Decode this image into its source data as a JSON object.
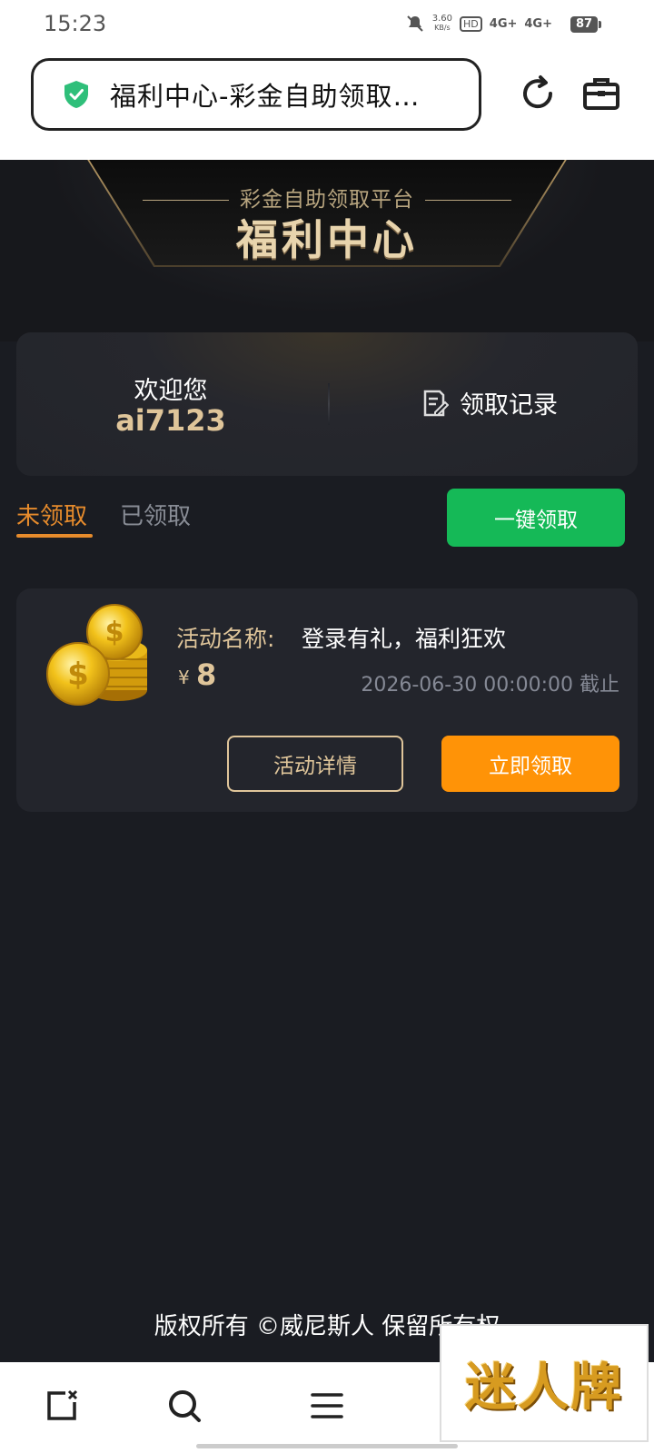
{
  "status_bar": {
    "time": "15:23",
    "speed_value": "3.60",
    "speed_unit": "KB/s",
    "hd": "HD",
    "network_1": "4G+",
    "network_2": "4G+",
    "battery": "87"
  },
  "browser": {
    "url_title": "福利中心-彩金自助领取…",
    "shield_icon": "shield-check-icon",
    "refresh_icon": "refresh-icon",
    "toolbox_icon": "toolbox-icon"
  },
  "hero": {
    "subtitle": "彩金自助领取平台",
    "title": "福利中心"
  },
  "welcome": {
    "label": "欢迎您",
    "username": "ai7123",
    "record_label": "领取记录",
    "record_icon": "document-edit-icon"
  },
  "tabs": {
    "unclaimed": "未领取",
    "claimed": "已领取",
    "active": "未领取"
  },
  "claim_all_label": "一键领取",
  "activity": {
    "label": "活动名称:",
    "name": "登录有礼，福利狂欢",
    "currency": "¥",
    "amount": "8",
    "deadline": "2026-06-30 00:00:00 截止",
    "detail_label": "活动详情",
    "claim_label": "立即领取",
    "image": "gold-coins"
  },
  "footer": {
    "copyright": "版权所有 ©威尼斯人 保留所有权"
  },
  "bottom_nav": {
    "icons": [
      "new-tab-icon",
      "search-icon",
      "menu-icon"
    ]
  },
  "watermark": {
    "text": "迷人牌"
  },
  "colors": {
    "accent_orange": "#ff9307",
    "gold_text": "#dfc59a",
    "green_button": "#15b957",
    "background": "#1a1c22"
  }
}
